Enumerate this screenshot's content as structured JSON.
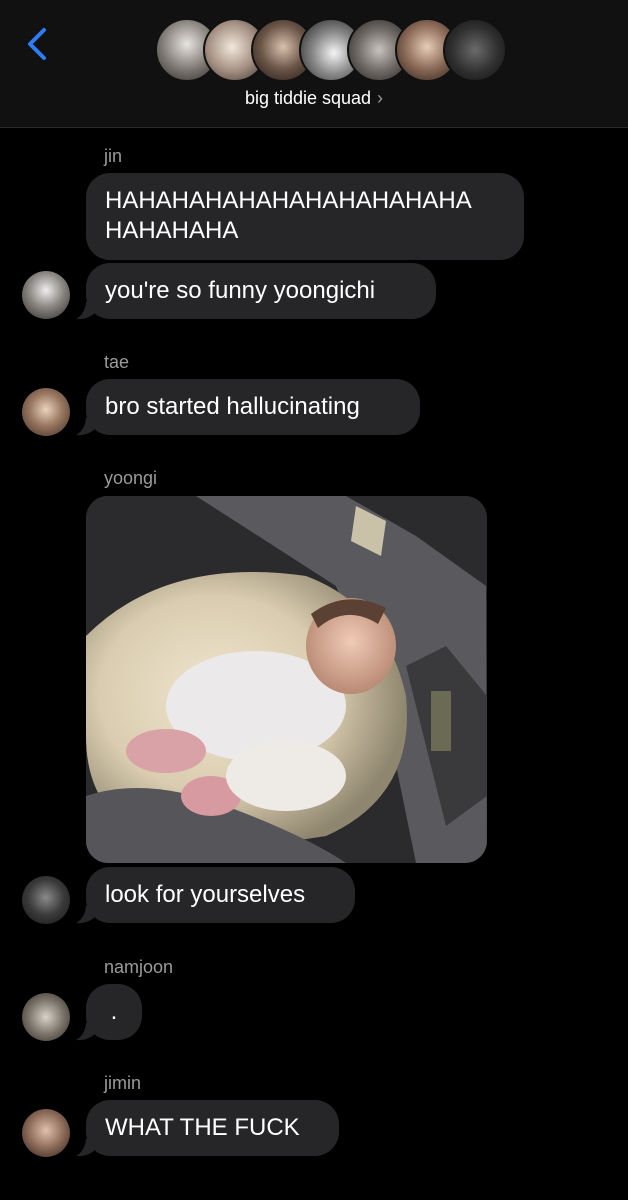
{
  "header": {
    "back_icon": "chevron-left-icon",
    "group_name": "big tiddie squad",
    "group_chevron": "›",
    "accent_color": "#2f7cf6"
  },
  "messages": [
    {
      "sender": "jin",
      "bubbles": [
        "HAHAHAHAHAHAHAHAHAHAHA\nHAHAHAHA",
        "you're so funny yoongichi"
      ]
    },
    {
      "sender": "tae",
      "bubbles": [
        "bro started hallucinating"
      ]
    },
    {
      "sender": "yoongi",
      "image": "photo of a sleeping baby in a car seat",
      "bubbles": [
        "look for yourselves"
      ]
    },
    {
      "sender": "namjoon",
      "bubbles": [
        "."
      ]
    },
    {
      "sender": "jimin",
      "bubbles": [
        "WHAT THE FUCK"
      ]
    }
  ],
  "colors": {
    "background": "#000000",
    "header_bg": "#111111",
    "bubble_bg": "#262628",
    "sender_label": "#9b9b9b"
  }
}
